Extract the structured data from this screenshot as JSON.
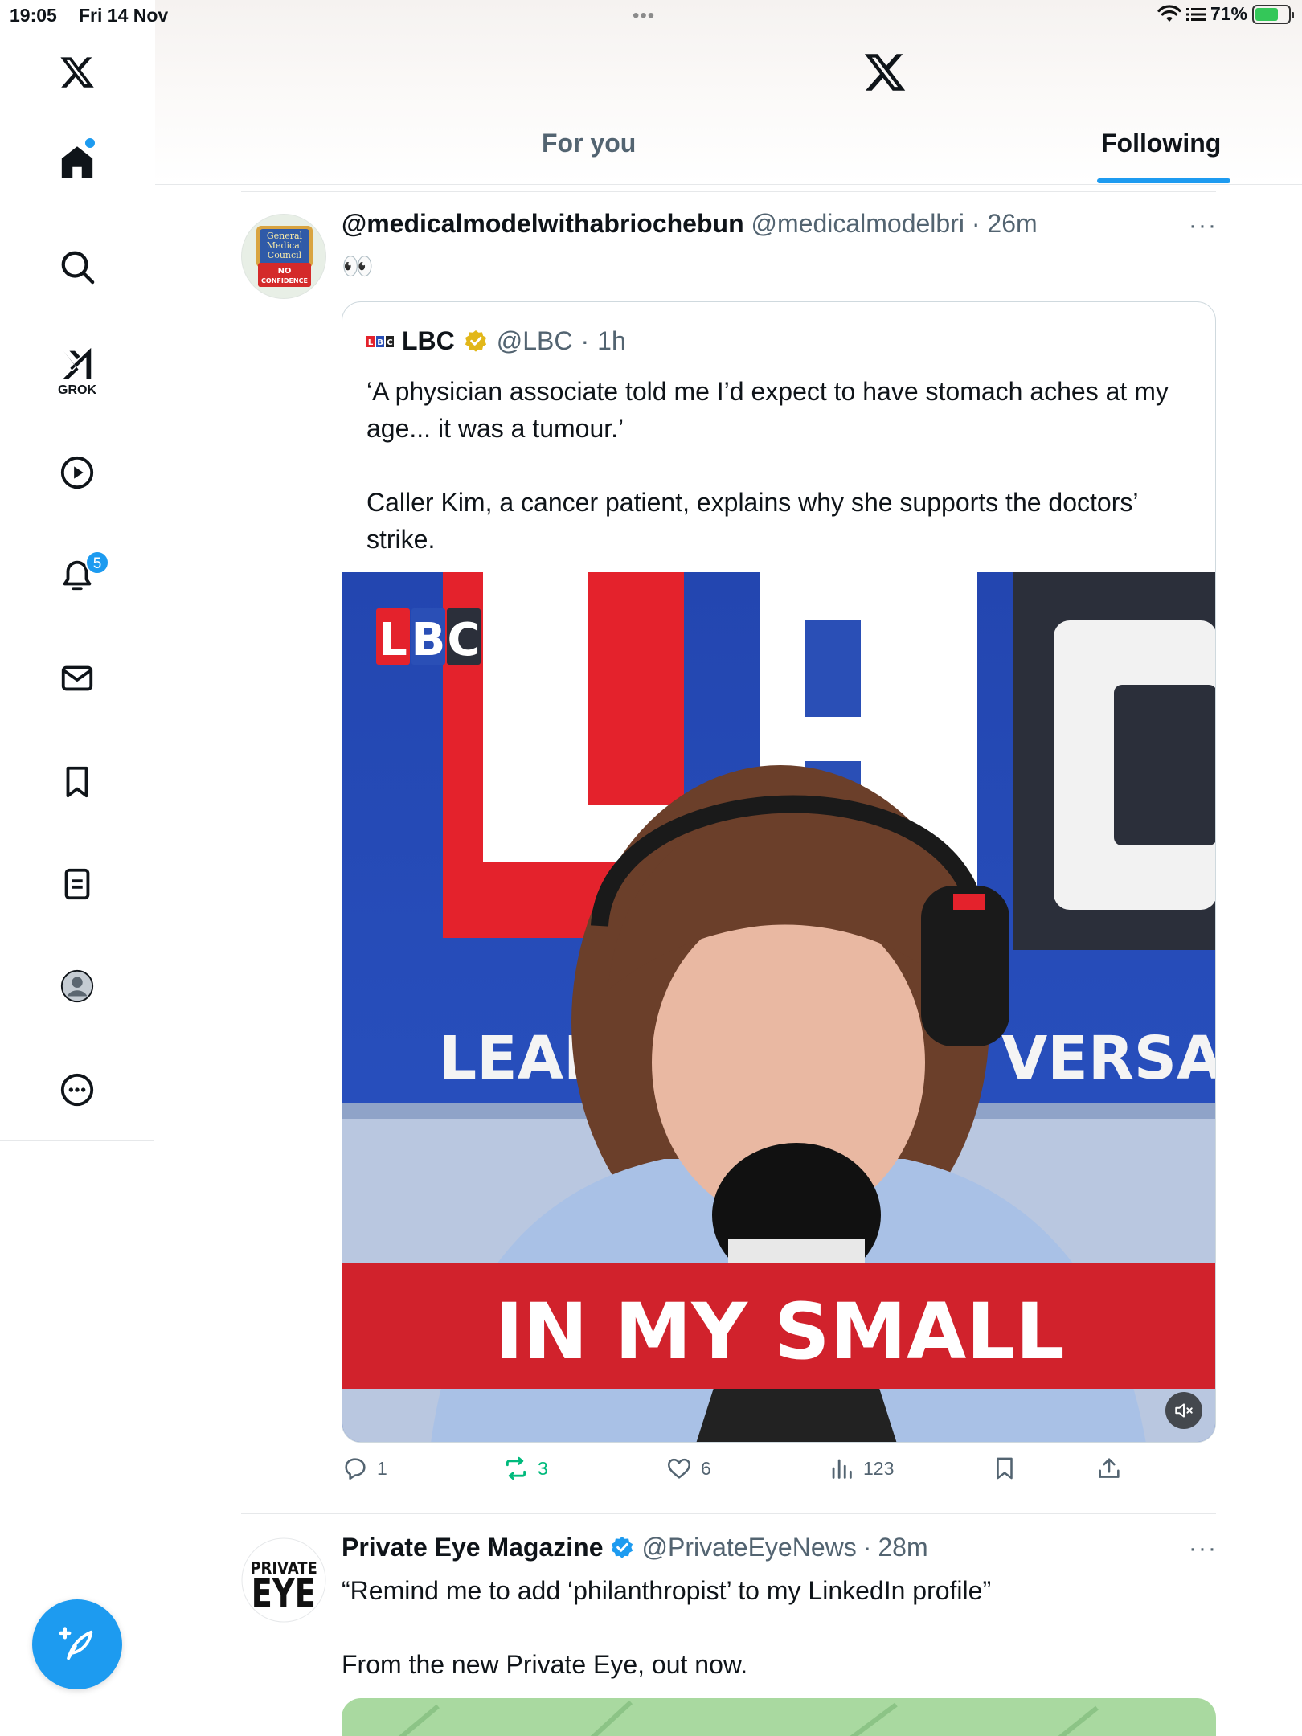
{
  "status_bar": {
    "time": "19:05",
    "date": "Fri 14 Nov",
    "battery": "71%",
    "battery_level": 0.71
  },
  "sidebar": {
    "grok_label": "GROK",
    "notifications_badge": "5",
    "items": [
      "home",
      "explore",
      "grok",
      "videos",
      "notifications",
      "messages",
      "bookmarks",
      "lists",
      "profile",
      "more"
    ]
  },
  "header": {
    "tabs": [
      {
        "label": "For you",
        "active": false
      },
      {
        "label": "Following",
        "active": true
      }
    ]
  },
  "tweets": [
    {
      "name": "@medicalmodelwithabriochebun",
      "handle": "@medicalmodelbri",
      "time": "26m",
      "text": "👀",
      "avatar_text": "General Medical Council NO CONFIDENCE",
      "quote": {
        "name": "LBC",
        "handle": "@LBC",
        "time": "1h",
        "text_line1": "‘A physician associate told me I’d expect to have stomach aches at my age... it was a tumour.’",
        "text_line2": "Caller Kim, a cancer patient, explains why she supports the doctors’ strike.",
        "media": {
          "logo": "LBC",
          "banner_left": "LEADI",
          "banner_right": "VERSATI",
          "caption": "IN MY SMALL",
          "bg_letters": "LBC"
        }
      },
      "actions": {
        "replies": "1",
        "reposts": "3",
        "likes": "6",
        "views": "123"
      }
    },
    {
      "name": "Private Eye Magazine",
      "handle": "@PrivateEyeNews",
      "time": "28m",
      "text_line1": "“Remind me to add ‘philanthropist’ to my LinkedIn profile”",
      "text_line2": "From the new Private Eye, out now.",
      "avatar_line1": "PRIVATE",
      "avatar_line2": "EYE"
    }
  ],
  "colors": {
    "accent": "#1d9bf0",
    "repost": "#00ba7c",
    "secondary_text": "#536471",
    "lbc_red": "#e4222c",
    "lbc_blue": "#2a4fb6"
  }
}
